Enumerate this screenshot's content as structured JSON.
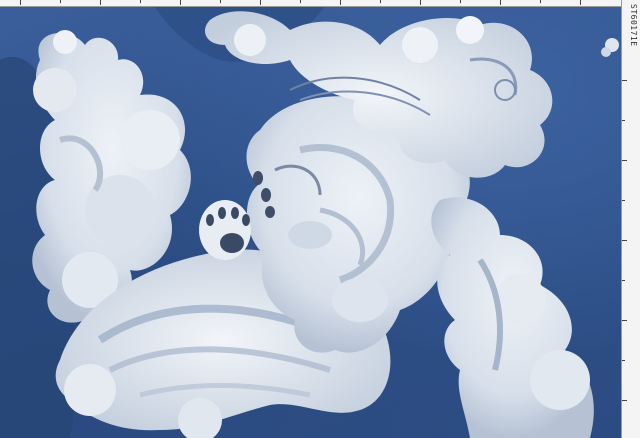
{
  "ruler": {
    "code": "ST60171E"
  },
  "colors": {
    "sky": "#2f5189",
    "sky_light": "#3c62a0",
    "cloud": "#e6ebf1",
    "cloud_shadow": "#b9c4d4",
    "cloud_dark": "#8e9fb9",
    "outline": "#4a5a78"
  }
}
